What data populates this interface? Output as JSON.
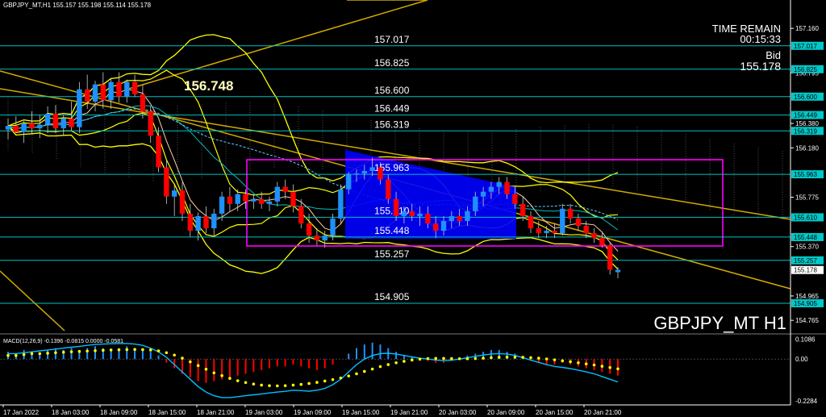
{
  "window": {
    "header": "GBPJPY_MT,H1  155.157 155.198 155.114 155.178",
    "symbol_caption": "GBPJPY_MT H1"
  },
  "info_panel": {
    "time_remain_label": "TIME REMAIN",
    "time_remain_value": "00:15:33",
    "bid_label": "Bid",
    "bid_value": "155.178"
  },
  "colors": {
    "background": "#000000",
    "bull_candle": "#1e90ff",
    "bear_candle": "#ff0000",
    "level_line": "#00c0c0",
    "bollinger": "#ffff00",
    "trendline": "#d4aa00",
    "box": "#ff00ff",
    "zone_fill": "#0000ff",
    "price_tag_bg": "#00c8c8",
    "current_price_tag_bg": "#ffffff",
    "macd_hist": "#1e90ff",
    "macd_signal": "#ffff00",
    "macd_line": "#00c0ff",
    "axis_text": "#ffffff"
  },
  "chart_data": [
    {
      "type": "candlestick",
      "symbol": "GBPJPY_MT",
      "timeframe": "H1",
      "ylim": [
        154.68,
        157.3
      ],
      "y_ticks": [
        "157.160",
        "156.795",
        "156.380",
        "156.180",
        "155.775",
        "155.370",
        "154.965",
        "154.765"
      ],
      "price_tags": [
        "157.017",
        "156.825",
        "156.600",
        "156.449",
        "156.319",
        "155.963",
        "155.610",
        "155.448",
        "155.257",
        "154.905"
      ],
      "current_price": "155.178",
      "horizontal_levels": [
        {
          "value": 157.017,
          "label": "157.017"
        },
        {
          "value": 156.825,
          "label": "156.825"
        },
        {
          "value": 156.6,
          "label": "156.600"
        },
        {
          "value": 156.449,
          "label": "156.449"
        },
        {
          "value": 156.319,
          "label": "156.319"
        },
        {
          "value": 155.963,
          "label": "155.963"
        },
        {
          "value": 155.61,
          "label": "155.610"
        },
        {
          "value": 155.448,
          "label": "155.448"
        },
        {
          "value": 155.257,
          "label": "155.257"
        },
        {
          "value": 154.905,
          "label": "154.905"
        }
      ],
      "annotation": {
        "label": "156.748",
        "value": 156.748
      },
      "x_labels": [
        "17 Jan 2022",
        "18 Jan 03:00",
        "18 Jan 09:00",
        "18 Jan 15:00",
        "18 Jan 21:00",
        "19 Jan 03:00",
        "19 Jan 09:00",
        "19 Jan 15:00",
        "19 Jan 21:00",
        "20 Jan 03:00",
        "20 Jan 09:00",
        "20 Jan 15:00",
        "20 Jan 21:00"
      ],
      "candles": [
        {
          "o": 156.33,
          "h": 156.42,
          "l": 156.25,
          "c": 156.36
        },
        {
          "o": 156.36,
          "h": 156.44,
          "l": 156.3,
          "c": 156.31
        },
        {
          "o": 156.31,
          "h": 156.4,
          "l": 156.22,
          "c": 156.38
        },
        {
          "o": 156.38,
          "h": 156.48,
          "l": 156.3,
          "c": 156.34
        },
        {
          "o": 156.34,
          "h": 156.45,
          "l": 156.26,
          "c": 156.37
        },
        {
          "o": 156.37,
          "h": 156.52,
          "l": 156.3,
          "c": 156.46
        },
        {
          "o": 156.46,
          "h": 156.53,
          "l": 156.3,
          "c": 156.34
        },
        {
          "o": 156.34,
          "h": 156.45,
          "l": 156.28,
          "c": 156.42
        },
        {
          "o": 156.42,
          "h": 156.56,
          "l": 156.32,
          "c": 156.35
        },
        {
          "o": 156.35,
          "h": 156.72,
          "l": 156.3,
          "c": 156.66
        },
        {
          "o": 156.66,
          "h": 156.78,
          "l": 156.5,
          "c": 156.56
        },
        {
          "o": 156.56,
          "h": 156.73,
          "l": 156.48,
          "c": 156.7
        },
        {
          "o": 156.7,
          "h": 156.8,
          "l": 156.5,
          "c": 156.57
        },
        {
          "o": 156.57,
          "h": 156.75,
          "l": 156.5,
          "c": 156.72
        },
        {
          "o": 156.72,
          "h": 156.8,
          "l": 156.55,
          "c": 156.6
        },
        {
          "o": 156.6,
          "h": 156.74,
          "l": 156.55,
          "c": 156.72
        },
        {
          "o": 156.72,
          "h": 156.78,
          "l": 156.6,
          "c": 156.62
        },
        {
          "o": 156.62,
          "h": 156.7,
          "l": 156.42,
          "c": 156.48
        },
        {
          "o": 156.48,
          "h": 156.52,
          "l": 156.22,
          "c": 156.28
        },
        {
          "o": 156.28,
          "h": 156.35,
          "l": 155.98,
          "c": 156.02
        },
        {
          "o": 156.02,
          "h": 156.08,
          "l": 155.72,
          "c": 155.78
        },
        {
          "o": 155.78,
          "h": 155.88,
          "l": 155.62,
          "c": 155.83
        },
        {
          "o": 155.83,
          "h": 155.9,
          "l": 155.58,
          "c": 155.64
        },
        {
          "o": 155.64,
          "h": 155.72,
          "l": 155.45,
          "c": 155.5
        },
        {
          "o": 155.5,
          "h": 155.65,
          "l": 155.42,
          "c": 155.62
        },
        {
          "o": 155.62,
          "h": 155.7,
          "l": 155.48,
          "c": 155.52
        },
        {
          "o": 155.52,
          "h": 155.68,
          "l": 155.46,
          "c": 155.64
        },
        {
          "o": 155.64,
          "h": 155.82,
          "l": 155.58,
          "c": 155.78
        },
        {
          "o": 155.78,
          "h": 155.86,
          "l": 155.66,
          "c": 155.72
        },
        {
          "o": 155.72,
          "h": 155.84,
          "l": 155.66,
          "c": 155.8
        },
        {
          "o": 155.8,
          "h": 155.84,
          "l": 155.68,
          "c": 155.74
        },
        {
          "o": 155.74,
          "h": 155.8,
          "l": 155.68,
          "c": 155.76
        },
        {
          "o": 155.76,
          "h": 155.82,
          "l": 155.68,
          "c": 155.72
        },
        {
          "o": 155.72,
          "h": 155.78,
          "l": 155.66,
          "c": 155.74
        },
        {
          "o": 155.74,
          "h": 155.9,
          "l": 155.7,
          "c": 155.86
        },
        {
          "o": 155.86,
          "h": 155.92,
          "l": 155.76,
          "c": 155.82
        },
        {
          "o": 155.82,
          "h": 155.88,
          "l": 155.65,
          "c": 155.7
        },
        {
          "o": 155.7,
          "h": 155.76,
          "l": 155.52,
          "c": 155.56
        },
        {
          "o": 155.56,
          "h": 155.64,
          "l": 155.4,
          "c": 155.46
        },
        {
          "o": 155.46,
          "h": 155.52,
          "l": 155.38,
          "c": 155.42
        },
        {
          "o": 155.42,
          "h": 155.5,
          "l": 155.36,
          "c": 155.46
        },
        {
          "o": 155.46,
          "h": 155.64,
          "l": 155.42,
          "c": 155.6
        },
        {
          "o": 155.6,
          "h": 155.88,
          "l": 155.56,
          "c": 155.84
        },
        {
          "o": 155.84,
          "h": 155.98,
          "l": 155.8,
          "c": 155.96
        },
        {
          "o": 155.96,
          "h": 156.0,
          "l": 155.9,
          "c": 155.97
        },
        {
          "o": 155.97,
          "h": 156.04,
          "l": 155.92,
          "c": 155.99
        },
        {
          "o": 155.99,
          "h": 156.1,
          "l": 155.95,
          "c": 156.02
        },
        {
          "o": 156.02,
          "h": 156.06,
          "l": 155.88,
          "c": 155.92
        },
        {
          "o": 155.92,
          "h": 155.96,
          "l": 155.72,
          "c": 155.76
        },
        {
          "o": 155.76,
          "h": 155.82,
          "l": 155.58,
          "c": 155.62
        },
        {
          "o": 155.62,
          "h": 155.7,
          "l": 155.56,
          "c": 155.66
        },
        {
          "o": 155.66,
          "h": 155.72,
          "l": 155.58,
          "c": 155.62
        },
        {
          "o": 155.62,
          "h": 155.7,
          "l": 155.54,
          "c": 155.64
        },
        {
          "o": 155.64,
          "h": 155.7,
          "l": 155.52,
          "c": 155.56
        },
        {
          "o": 155.56,
          "h": 155.62,
          "l": 155.44,
          "c": 155.5
        },
        {
          "o": 155.5,
          "h": 155.62,
          "l": 155.46,
          "c": 155.58
        },
        {
          "o": 155.58,
          "h": 155.66,
          "l": 155.52,
          "c": 155.62
        },
        {
          "o": 155.62,
          "h": 155.68,
          "l": 155.54,
          "c": 155.58
        },
        {
          "o": 155.58,
          "h": 155.7,
          "l": 155.54,
          "c": 155.66
        },
        {
          "o": 155.66,
          "h": 155.82,
          "l": 155.62,
          "c": 155.78
        },
        {
          "o": 155.78,
          "h": 155.86,
          "l": 155.7,
          "c": 155.82
        },
        {
          "o": 155.82,
          "h": 155.9,
          "l": 155.76,
          "c": 155.86
        },
        {
          "o": 155.86,
          "h": 155.94,
          "l": 155.8,
          "c": 155.9
        },
        {
          "o": 155.9,
          "h": 155.94,
          "l": 155.76,
          "c": 155.8
        },
        {
          "o": 155.8,
          "h": 155.86,
          "l": 155.68,
          "c": 155.72
        },
        {
          "o": 155.72,
          "h": 155.78,
          "l": 155.58,
          "c": 155.62
        },
        {
          "o": 155.62,
          "h": 155.66,
          "l": 155.48,
          "c": 155.52
        },
        {
          "o": 155.52,
          "h": 155.58,
          "l": 155.44,
          "c": 155.48
        },
        {
          "o": 155.48,
          "h": 155.54,
          "l": 155.44,
          "c": 155.5
        },
        {
          "o": 155.5,
          "h": 155.56,
          "l": 155.44,
          "c": 155.48
        },
        {
          "o": 155.48,
          "h": 155.72,
          "l": 155.46,
          "c": 155.68
        },
        {
          "o": 155.68,
          "h": 155.72,
          "l": 155.56,
          "c": 155.6
        },
        {
          "o": 155.6,
          "h": 155.64,
          "l": 155.5,
          "c": 155.54
        },
        {
          "o": 155.54,
          "h": 155.58,
          "l": 155.44,
          "c": 155.48
        },
        {
          "o": 155.48,
          "h": 155.52,
          "l": 155.4,
          "c": 155.44
        },
        {
          "o": 155.44,
          "h": 155.48,
          "l": 155.36,
          "c": 155.38
        },
        {
          "o": 155.38,
          "h": 155.4,
          "l": 155.14,
          "c": 155.18
        },
        {
          "o": 155.16,
          "h": 155.2,
          "l": 155.11,
          "c": 155.18
        }
      ]
    },
    {
      "type": "bar",
      "indicator": "MACD",
      "label": "MACD(12,26,9) -0.1396 -0.0815 0.0000 -0.0581",
      "ylim": [
        -0.25,
        0.12
      ],
      "y_ticks": [
        "0.1086",
        "0.00",
        "-0.2284"
      ],
      "series": [
        {
          "name": "histogram",
          "values": [
            0.04,
            0.03,
            0.05,
            0.04,
            0.03,
            0.05,
            0.06,
            0.05,
            0.06,
            0.05,
            0.06,
            0.07,
            0.06,
            0.05,
            0.06,
            0.07,
            0.06,
            0.05,
            0.04,
            0.02,
            -0.02,
            -0.05,
            -0.08,
            -0.1,
            -0.12,
            -0.13,
            -0.12,
            -0.11,
            -0.1,
            -0.09,
            -0.08,
            -0.07,
            -0.06,
            -0.05,
            -0.04,
            -0.04,
            -0.03,
            -0.04,
            -0.05,
            -0.06,
            -0.05,
            -0.03,
            0.0,
            0.03,
            0.06,
            0.08,
            0.09,
            0.08,
            0.06,
            0.04,
            0.02,
            0.01,
            0.0,
            -0.01,
            -0.02,
            -0.02,
            -0.01,
            0.01,
            0.02,
            0.03,
            0.04,
            0.05,
            0.05,
            0.04,
            0.03,
            0.01,
            -0.01,
            -0.02,
            -0.03,
            -0.03,
            -0.02,
            -0.03,
            -0.04,
            -0.05,
            -0.06,
            -0.07,
            -0.08,
            -0.09
          ]
        },
        {
          "name": "signal",
          "values": [
            0.02,
            0.02,
            0.025,
            0.03,
            0.03,
            0.032,
            0.035,
            0.038,
            0.04,
            0.042,
            0.044,
            0.046,
            0.048,
            0.05,
            0.051,
            0.052,
            0.053,
            0.052,
            0.05,
            0.045,
            0.035,
            0.022,
            0.005,
            -0.015,
            -0.035,
            -0.055,
            -0.075,
            -0.09,
            -0.105,
            -0.118,
            -0.128,
            -0.136,
            -0.142,
            -0.145,
            -0.146,
            -0.145,
            -0.142,
            -0.138,
            -0.133,
            -0.127,
            -0.12,
            -0.112,
            -0.103,
            -0.092,
            -0.08,
            -0.067,
            -0.054,
            -0.041,
            -0.03,
            -0.02,
            -0.012,
            -0.005,
            0.0,
            0.003,
            0.004,
            0.004,
            0.003,
            0.002,
            0.002,
            0.003,
            0.005,
            0.008,
            0.01,
            0.011,
            0.011,
            0.01,
            0.008,
            0.005,
            0.001,
            -0.004,
            -0.009,
            -0.014,
            -0.02,
            -0.026,
            -0.032,
            -0.039,
            -0.046,
            -0.053
          ]
        },
        {
          "name": "macd",
          "values": [
            0.03,
            0.03,
            0.035,
            0.04,
            0.045,
            0.05,
            0.055,
            0.06,
            0.065,
            0.07,
            0.075,
            0.08,
            0.082,
            0.084,
            0.085,
            0.085,
            0.082,
            0.075,
            0.06,
            0.04,
            0.01,
            -0.03,
            -0.07,
            -0.11,
            -0.15,
            -0.18,
            -0.2,
            -0.21,
            -0.21,
            -0.205,
            -0.2,
            -0.195,
            -0.19,
            -0.185,
            -0.18,
            -0.176,
            -0.17,
            -0.172,
            -0.175,
            -0.17,
            -0.16,
            -0.14,
            -0.11,
            -0.07,
            -0.03,
            0.0,
            0.02,
            0.03,
            0.032,
            0.028,
            0.02,
            0.012,
            0.005,
            0.0,
            -0.005,
            -0.008,
            -0.006,
            0.0,
            0.008,
            0.015,
            0.022,
            0.028,
            0.03,
            0.028,
            0.02,
            0.008,
            -0.005,
            -0.018,
            -0.03,
            -0.04,
            -0.045,
            -0.052,
            -0.06,
            -0.07,
            -0.08,
            -0.095,
            -0.11,
            -0.125
          ]
        }
      ]
    }
  ]
}
